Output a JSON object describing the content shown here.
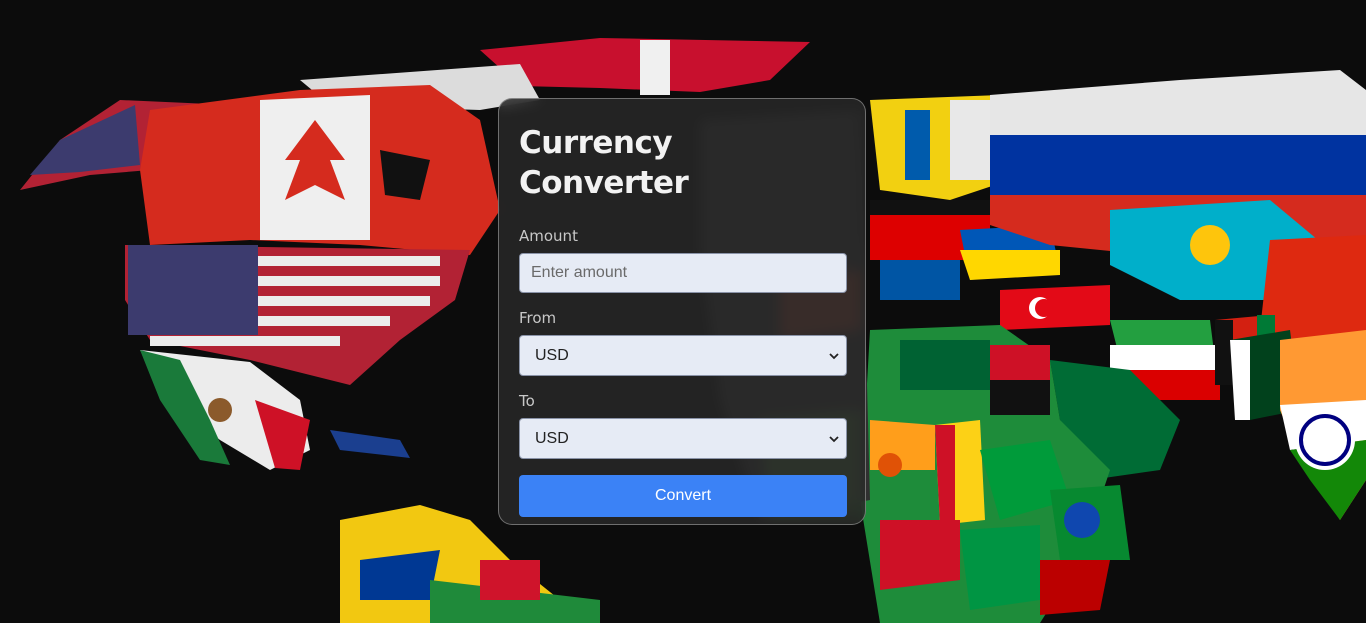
{
  "converter": {
    "title": "Currency Converter",
    "amount_label": "Amount",
    "amount_placeholder": "Enter amount",
    "amount_value": "",
    "from_label": "From",
    "from_selected": "USD",
    "to_label": "To",
    "to_selected": "USD",
    "convert_label": "Convert"
  },
  "background": {
    "description_icon": "world-map-flags-image"
  },
  "colors": {
    "accent": "#3b82f6",
    "card_bg": "#282828",
    "input_bg": "#e6ebf5",
    "page_bg": "#0c0c0c"
  }
}
